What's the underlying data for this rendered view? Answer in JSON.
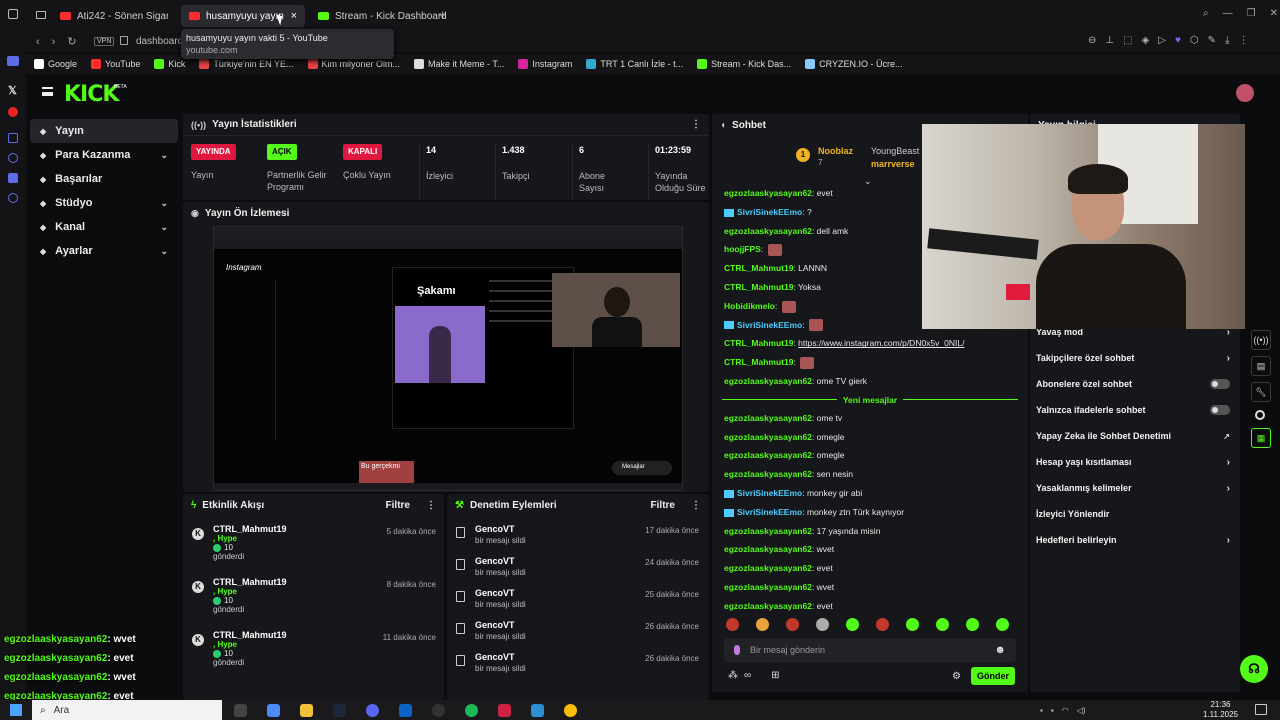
{
  "browser": {
    "tabs": [
      {
        "label": "Ati242 - Sönen Sigaralar",
        "icon": "youtube-icon"
      },
      {
        "label": "husamyuyu yayın va",
        "icon": "youtube-icon"
      },
      {
        "label": "Stream - Kick Dashboard",
        "icon": "kick-icon"
      }
    ],
    "address": "dashboard",
    "vpn_label": "VPN",
    "tooltip_title": "husamyuyu yayın vakti 5 - YouTube",
    "tooltip_url": "youtube.com",
    "bookmarks": [
      {
        "label": "Google",
        "color": "#ffffff"
      },
      {
        "label": "YouTube",
        "color": "#ff2d2d"
      },
      {
        "label": "Kick",
        "color": "#53fc18"
      },
      {
        "label": "Türkiye'nin EN YE...",
        "color": "#e44"
      },
      {
        "label": "Kim milyoner Olm...",
        "color": "#e44"
      },
      {
        "label": "Make it Meme - T...",
        "color": "#ddd"
      },
      {
        "label": "Instagram",
        "color": "#d6249f"
      },
      {
        "label": "TRT 1 Canlı İzle - t...",
        "color": "#3ac"
      },
      {
        "label": "Stream - Kick Das...",
        "color": "#53fc18"
      },
      {
        "label": "CRYZEN.IO - Ücre...",
        "color": "#8cf"
      }
    ]
  },
  "nav": {
    "logo": "KICK",
    "logo_sup": "BETA"
  },
  "sidebar": {
    "items": [
      {
        "label": "Yayın",
        "icon": "video-icon",
        "active": true,
        "chevron": false
      },
      {
        "label": "Para Kazanma",
        "icon": "money-icon",
        "chevron": true
      },
      {
        "label": "Başarılar",
        "icon": "trophy-icon",
        "chevron": false
      },
      {
        "label": "Stüdyo",
        "icon": "studio-icon",
        "chevron": true
      },
      {
        "label": "Kanal",
        "icon": "channel-icon",
        "chevron": true
      },
      {
        "label": "Ayarlar",
        "icon": "gear-icon",
        "chevron": true
      }
    ]
  },
  "stats": {
    "title": "Yayın İstatistikleri",
    "items": [
      {
        "value": "YAYINDA",
        "label": "Yayın",
        "badge": "#e0173f"
      },
      {
        "value": "AÇIK",
        "label": "Partnerlik Gelir Programı",
        "badge": "#53fc18"
      },
      {
        "value": "KAPALI",
        "label": "Çoklu Yayın",
        "badge": "#e0173f"
      },
      {
        "value": "14",
        "label": "İzleyici"
      },
      {
        "value": "1.438",
        "label": "Takipçi"
      },
      {
        "value": "6",
        "label": "Abone Sayısı"
      },
      {
        "value": "01:23:59",
        "label": "Yayında Olduğu Süre"
      }
    ]
  },
  "preview": {
    "title": "Yayın Ön İzlemesi",
    "inner_heading": "Şakamı",
    "inner_app": "Instagram",
    "inner_caption": "Bu gerçekmi",
    "inner_msg": "Mesajlar"
  },
  "activity": {
    "title": "Etkinlik Akışı",
    "filter": "Filtre",
    "items": [
      {
        "user": "CTRL_Mahmut19",
        "type": ", Hype",
        "amount": "10",
        "verb": "gönderdi",
        "time": "5 dakika önce"
      },
      {
        "user": "CTRL_Mahmut19",
        "type": ", Hype",
        "amount": "10",
        "verb": "gönderdi",
        "time": "8 dakika önce"
      },
      {
        "user": "CTRL_Mahmut19",
        "type": ", Hype",
        "amount": "10",
        "verb": "gönderdi",
        "time": "11 dakika önce"
      }
    ]
  },
  "moderation": {
    "title": "Denetim Eylemleri",
    "filter": "Filtre",
    "items": [
      {
        "user": "GencoVT",
        "action": "bir mesajı sildi",
        "time": "17 dakika önce"
      },
      {
        "user": "GencoVT",
        "action": "bir mesajı sildi",
        "time": "24 dakika önce"
      },
      {
        "user": "GencoVT",
        "action": "bir mesajı sildi",
        "time": "25 dakika önce"
      },
      {
        "user": "GencoVT",
        "action": "bir mesajı sildi",
        "time": "26 dakika önce"
      },
      {
        "user": "GencoVT",
        "action": "bir mesajı sildi",
        "time": "26 dakika önce"
      }
    ]
  },
  "chat": {
    "title": "Sohbet",
    "pinned": [
      {
        "user": "Nooblaz",
        "count": "7"
      },
      {
        "user": "YoungBeast"
      },
      {
        "user": "marrverse"
      }
    ],
    "messages": [
      {
        "user": "egzozlaaskyasayan62",
        "text": "evet",
        "blue": false
      },
      {
        "user": "SivriSinekEEmo",
        "text": "?",
        "blue": true
      },
      {
        "user": "egzozlaaskyasayan62",
        "text": "dell amk",
        "blue": false
      },
      {
        "user": "hoojjFPS",
        "text": "",
        "blue": false,
        "emote": true
      },
      {
        "user": "CTRL_Mahmut19",
        "text": "LANNN",
        "blue": false
      },
      {
        "user": "CTRL_Mahmut19",
        "text": "Yoksa",
        "blue": false
      },
      {
        "user": "Hobidikmelo",
        "text": "",
        "blue": false,
        "emote": true
      },
      {
        "user": "SivriSinekEEmo",
        "text": "",
        "blue": true,
        "emote": true
      },
      {
        "user": "CTRL_Mahmut19",
        "text": "https://www.instagram.com/p/DN0x5v_0NIL/",
        "blue": false,
        "link": true
      },
      {
        "user": "CTRL_Mahmut19",
        "text": "",
        "blue": false,
        "emote": true
      },
      {
        "user": "egzozlaaskyasayan62",
        "text": "ome TV gierk",
        "blue": false
      }
    ],
    "divider": "Yeni mesajlar",
    "messages2": [
      {
        "user": "egzozlaaskyasayan62",
        "text": "ome tv",
        "blue": false
      },
      {
        "user": "egzozlaaskyasayan62",
        "text": "omegle",
        "blue": false
      },
      {
        "user": "egzozlaaskyasayan62",
        "text": "omegle",
        "blue": false
      },
      {
        "user": "egzozlaaskyasayan62",
        "text": "sen nesin",
        "blue": false
      },
      {
        "user": "SivriSinekEEmo",
        "text": "monkey gir abi",
        "blue": true
      },
      {
        "user": "SivriSinekEEmo",
        "text": "monkey ztn Türk kaynıyor",
        "blue": true
      },
      {
        "user": "egzozlaaskyasayan62",
        "text": "17 yaşında misin",
        "blue": false
      },
      {
        "user": "egzozlaaskyasayan62",
        "text": "wvet",
        "blue": false
      },
      {
        "user": "egzozlaaskyasayan62",
        "text": "evet",
        "blue": false
      },
      {
        "user": "egzozlaaskyasayan62",
        "text": "wvet",
        "blue": false
      },
      {
        "user": "egzozlaaskyasayan62",
        "text": "evet",
        "blue": false
      }
    ],
    "placeholder": "Bir mesaj gönderin",
    "send": "Gönder",
    "points": "∞"
  },
  "settings": {
    "title": "Yayın bilgisi",
    "items": [
      {
        "label": "Yavaş mod",
        "kind": "arrow"
      },
      {
        "label": "Takipçilere özel sohbet",
        "kind": "arrow"
      },
      {
        "label": "Abonelere özel sohbet",
        "kind": "toggle"
      },
      {
        "label": "Yalnızca ifadelerle sohbet",
        "kind": "toggle"
      },
      {
        "label": "Yapay Zeka ile Sohbet Denetimi",
        "kind": "external"
      },
      {
        "label": "Hesap yaşı kısıtlaması",
        "kind": "arrow"
      },
      {
        "label": "Yasaklanmış kelimeler",
        "kind": "arrow"
      },
      {
        "label": "İzleyici Yönlendir",
        "kind": "none"
      },
      {
        "label": "Hedefleri belirleyin",
        "kind": "arrow"
      }
    ]
  },
  "overlay_chat": [
    {
      "user": "egzozlaaskyasayan62",
      "text": ": wvet"
    },
    {
      "user": "egzozlaaskyasayan62",
      "text": ": evet"
    },
    {
      "user": "egzozlaaskyasayan62",
      "text": ": wvet"
    },
    {
      "user": "egzozlaaskyasayan62",
      "text": ": evet"
    }
  ],
  "taskbar": {
    "search": "Ara",
    "time": "21:36",
    "date": "1.11.2025"
  }
}
